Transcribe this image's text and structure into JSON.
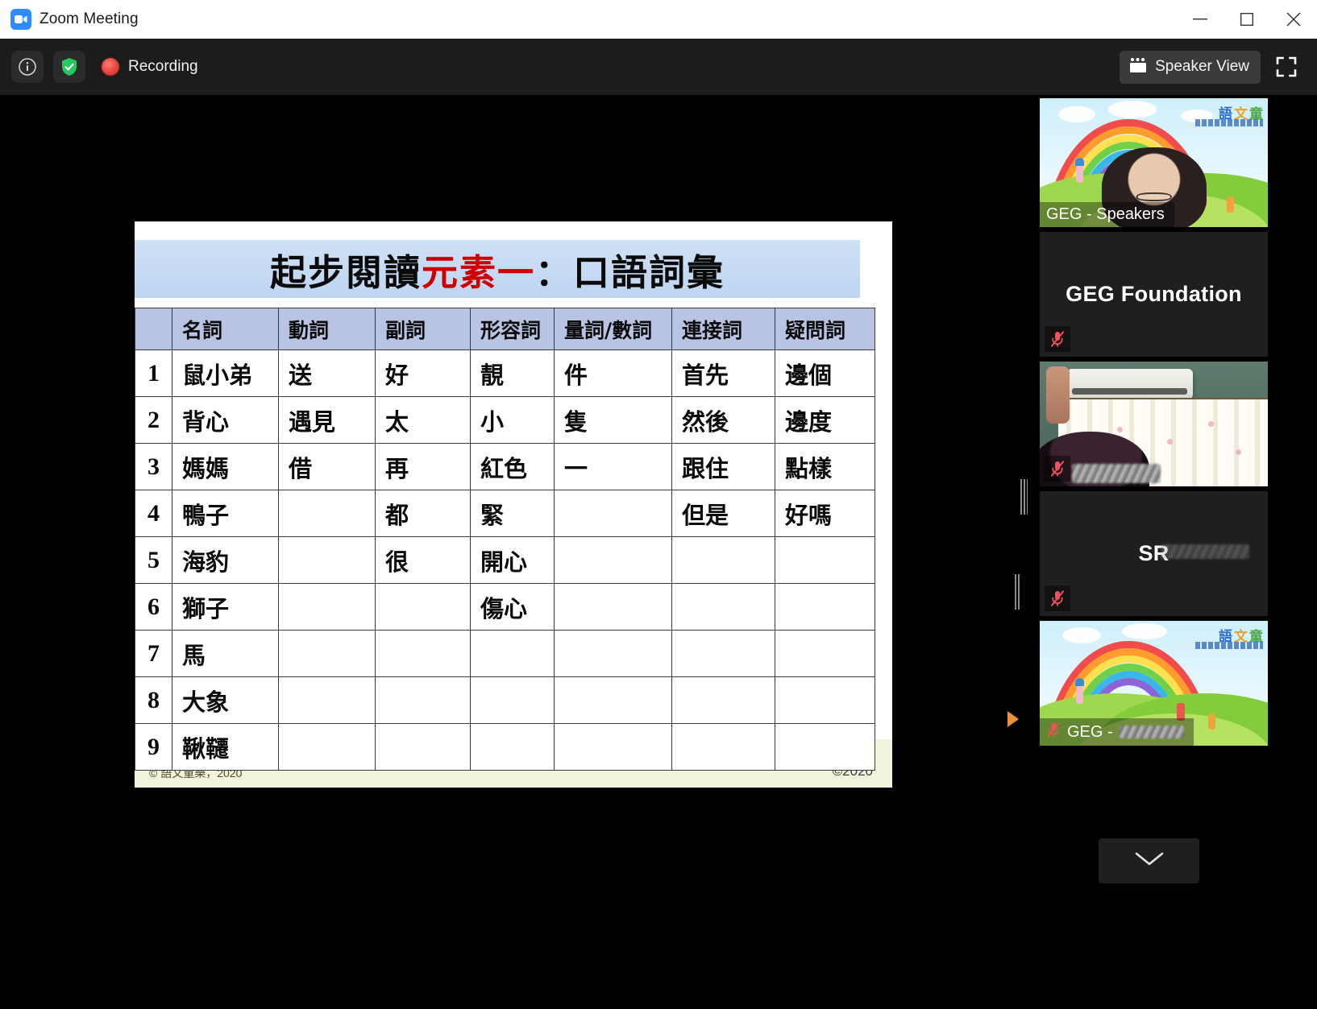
{
  "window": {
    "title": "Zoom Meeting",
    "app_icon": "zoom-video-icon",
    "controls": {
      "minimize": "minimize-icon",
      "maximize": "maximize-icon",
      "close": "close-icon"
    }
  },
  "toolbar": {
    "info_icon": "info-icon",
    "encryption_icon": "shield-check-icon",
    "recording_icon": "recording-dot-icon",
    "recording_label": "Recording",
    "view_mode_label": "Speaker View",
    "view_mode_icon": "grid-view-icon",
    "fullscreen_icon": "fullscreen-icon"
  },
  "colors": {
    "accent_blue": "#2d8cff",
    "recording_red": "#e8413a",
    "active_speaker_border": "#f2f24a",
    "mute_red": "#f1515a",
    "title_band": "#c5daf3",
    "table_header": "#b9c4e4",
    "title_highlight_red": "#cc0000"
  },
  "slide": {
    "title_prefix": "起步閱讀",
    "title_highlight": "元素一",
    "title_suffix": "：口語詞彙",
    "footer_left": "© 語文童樂，2020",
    "footer_right": "©2020",
    "table": {
      "columns": [
        "",
        "名詞",
        "動詞",
        "副詞",
        "形容詞",
        "量詞/數詞",
        "連接詞",
        "疑問詞"
      ],
      "rows": [
        [
          "1",
          "鼠小弟",
          "送",
          "好",
          "靚",
          "件",
          "首先",
          "邊個"
        ],
        [
          "2",
          "背心",
          "遇見",
          "太",
          "小",
          "隻",
          "然後",
          "邊度"
        ],
        [
          "3",
          "媽媽",
          "借",
          "再",
          "紅色",
          "一",
          "跟住",
          "點樣"
        ],
        [
          "4",
          "鴨子",
          "",
          "都",
          "緊",
          "",
          "但是",
          "好嗎"
        ],
        [
          "5",
          "海豹",
          "",
          "很",
          "開心",
          "",
          "",
          ""
        ],
        [
          "6",
          "獅子",
          "",
          "",
          "傷心",
          "",
          "",
          ""
        ],
        [
          "7",
          "馬",
          "",
          "",
          "",
          "",
          "",
          ""
        ],
        [
          "8",
          "大象",
          "",
          "",
          "",
          "",
          "",
          ""
        ],
        [
          "9",
          "鞦韆",
          "",
          "",
          "",
          "",
          "",
          ""
        ]
      ]
    },
    "next_slide_arrow": "next-slide-arrow-icon"
  },
  "participants": [
    {
      "name": "GEG - Speakers",
      "label_position": "bottom-left",
      "active_speaker": true,
      "muted": false,
      "video_on": true,
      "background_logo": "語文童樂"
    },
    {
      "name": "GEG Foundation",
      "label_position": "center",
      "active_speaker": false,
      "muted": true,
      "video_on": false,
      "mute_icon": "mic-muted-icon"
    },
    {
      "name": "",
      "label_position": "bottom-left",
      "active_speaker": false,
      "muted": true,
      "video_on": true,
      "mute_icon": "mic-muted-icon"
    },
    {
      "name": "SR",
      "label_position": "center",
      "active_speaker": false,
      "muted": true,
      "video_on": false,
      "mute_icon": "mic-muted-icon"
    },
    {
      "name": "GEG -",
      "label_position": "bottom-left",
      "active_speaker": false,
      "muted": true,
      "video_on": true,
      "mute_icon": "mic-muted-icon",
      "background_logo": "語文童樂"
    }
  ],
  "strip": {
    "scroll_down_icon": "chevron-down-icon",
    "drag_handle": "panel-drag-handle"
  }
}
